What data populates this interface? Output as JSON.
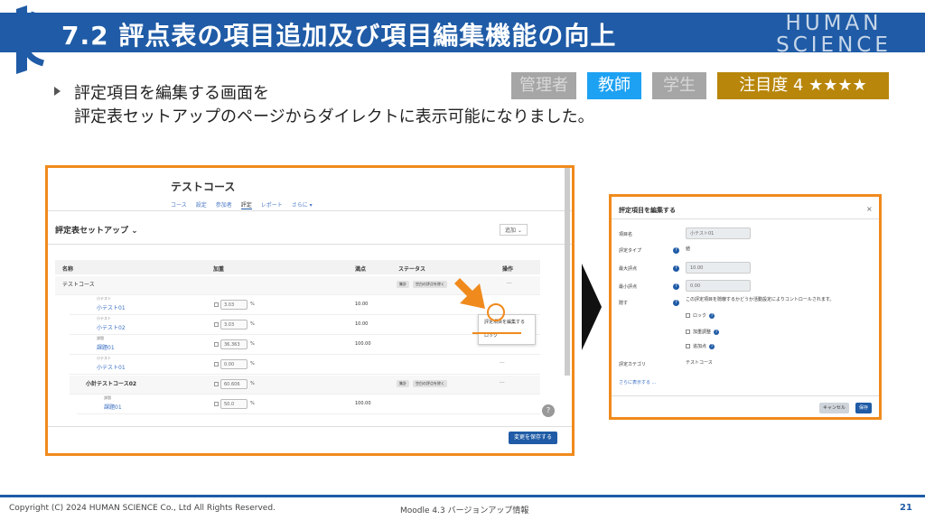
{
  "slide": {
    "title": "7.2 評点表の項目追加及び項目編集機能の向上",
    "brand_line1": "HUMAN",
    "brand_line2": "SCIENCE",
    "badges": {
      "admin": "管理者",
      "teacher": "教師",
      "student": "学生",
      "attention": "注目度 4 ★★★★"
    },
    "description_line1": "評定項目を編集する画面を",
    "description_line2": "評定表セットアップのページからダイレクトに表示可能になりました。"
  },
  "gradebook": {
    "course_title": "テストコース",
    "tabs": [
      "コース",
      "設定",
      "参加者",
      "評定",
      "レポート",
      "さらに ▾"
    ],
    "setup_select": "評定表セットアップ ⌄",
    "add_select": "追加 ⌄",
    "columns": {
      "name": "名称",
      "weight": "加重",
      "max": "満点",
      "status": "ステータス",
      "actions": "操作"
    },
    "category_row": {
      "name": "テストコース",
      "tag1": "集計",
      "tag2": "空白の評点を除く"
    },
    "rows": [
      {
        "type": "小テスト",
        "name": "小テスト01",
        "weight": "3.03",
        "max": "10.00"
      },
      {
        "type": "小テスト",
        "name": "小テスト02",
        "weight": "3.03",
        "max": "10.00"
      },
      {
        "type": "課題",
        "name": "課題01",
        "weight": "36.363",
        "max": "100.00"
      },
      {
        "type": "小テスト",
        "name": "小テスト01",
        "weight": "0.00",
        "max": ""
      }
    ],
    "subcategory_row": {
      "name": "小計テストコース02",
      "weight": "60.606",
      "tag1": "集計",
      "tag2": "空白の評点を除く"
    },
    "last_row": {
      "type": "課題",
      "name": "課題01",
      "weight": "50.0",
      "max": "100.00"
    },
    "pct": "%",
    "ops_dots": "···",
    "menu_edit": "評定項目を編集する",
    "menu_lock": "ロック",
    "help": "?",
    "save_button": "変更を保存する"
  },
  "dialog": {
    "title": "評定項目を編集する",
    "close": "×",
    "labels": {
      "item_name": "項目名",
      "grade_type": "評定タイプ",
      "max_grade": "最大評点",
      "min_grade": "最小評点",
      "hidden": "隠す",
      "category": "評定カテゴリ"
    },
    "values": {
      "item_name": "小テスト01",
      "grade_type": "値",
      "max_grade": "10.00",
      "min_grade": "0.00",
      "hidden_note": "この評定項目を隠蔽するかどうか活動設定によりコントロールされます。",
      "category": "テストコース"
    },
    "checks": [
      "ロック",
      "加重調整",
      "追加点"
    ],
    "more_link": "さらに表示する ...",
    "cancel": "キャンセル",
    "save": "保存"
  },
  "footer": {
    "copyright": "Copyright (C) 2024 HUMAN SCIENCE Co., Ltd All Rights Reserved.",
    "doc_title": "Moodle 4.3 バージョンアップ情報",
    "page": "21"
  },
  "colors": {
    "primary_blue": "#1f5ba6",
    "highlight_orange": "#f08a1c",
    "teacher_badge": "#1da1f2",
    "attention_badge": "#b8860b"
  }
}
